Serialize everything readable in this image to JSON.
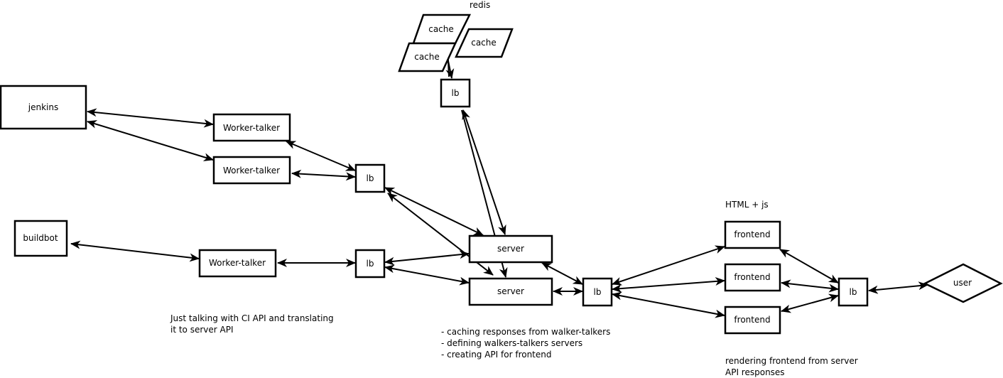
{
  "diagram": {
    "colors": {
      "stroke": "#000000",
      "fill": "#ffffff",
      "text": "#000000"
    },
    "nodes": [
      {
        "id": "jenkins",
        "label": "jenkins",
        "shape": "rect"
      },
      {
        "id": "wt1",
        "label": "Worker-talker",
        "shape": "rect"
      },
      {
        "id": "wt2",
        "label": "Worker-talker",
        "shape": "rect"
      },
      {
        "id": "buildbot",
        "label": "buildbot",
        "shape": "rect"
      },
      {
        "id": "wt3",
        "label": "Worker-talker",
        "shape": "rect"
      },
      {
        "id": "lb1",
        "label": "lb",
        "shape": "rect"
      },
      {
        "id": "lb2",
        "label": "lb",
        "shape": "rect"
      },
      {
        "id": "cache1",
        "label": "cache",
        "shape": "parallelogram"
      },
      {
        "id": "cache2",
        "label": "cache",
        "shape": "parallelogram"
      },
      {
        "id": "cache3",
        "label": "cache",
        "shape": "parallelogram"
      },
      {
        "id": "lb_redis",
        "label": "lb",
        "shape": "rect"
      },
      {
        "id": "server1",
        "label": "server",
        "shape": "rect"
      },
      {
        "id": "server2",
        "label": "server",
        "shape": "rect"
      },
      {
        "id": "lb3",
        "label": "lb",
        "shape": "rect"
      },
      {
        "id": "fe1",
        "label": "frontend",
        "shape": "rect"
      },
      {
        "id": "fe2",
        "label": "frontend",
        "shape": "rect"
      },
      {
        "id": "fe3",
        "label": "frontend",
        "shape": "rect"
      },
      {
        "id": "lb4",
        "label": "lb",
        "shape": "rect"
      },
      {
        "id": "user",
        "label": "user",
        "shape": "diamond"
      }
    ],
    "edges": [
      {
        "from": "jenkins",
        "to": "wt1",
        "bidirectional": true
      },
      {
        "from": "jenkins",
        "to": "wt2",
        "bidirectional": true
      },
      {
        "from": "wt1",
        "to": "lb1",
        "bidirectional": true
      },
      {
        "from": "wt2",
        "to": "lb1",
        "bidirectional": true
      },
      {
        "from": "buildbot",
        "to": "wt3",
        "bidirectional": true
      },
      {
        "from": "wt3",
        "to": "lb2",
        "bidirectional": true
      },
      {
        "from": "lb1",
        "to": "server1",
        "bidirectional": true
      },
      {
        "from": "lb1",
        "to": "server2",
        "bidirectional": true
      },
      {
        "from": "lb2",
        "to": "server1",
        "bidirectional": true
      },
      {
        "from": "lb2",
        "to": "server2",
        "bidirectional": true
      },
      {
        "from": "cache3",
        "to": "lb_redis",
        "bidirectional": true
      },
      {
        "from": "lb_redis",
        "to": "server1",
        "bidirectional": true
      },
      {
        "from": "lb_redis",
        "to": "server2",
        "bidirectional": true
      },
      {
        "from": "server1",
        "to": "lb3",
        "bidirectional": true
      },
      {
        "from": "server2",
        "to": "lb3",
        "bidirectional": true
      },
      {
        "from": "lb3",
        "to": "fe1",
        "bidirectional": true
      },
      {
        "from": "lb3",
        "to": "fe2",
        "bidirectional": true
      },
      {
        "from": "lb3",
        "to": "fe3",
        "bidirectional": true
      },
      {
        "from": "fe1",
        "to": "lb4",
        "bidirectional": true
      },
      {
        "from": "fe2",
        "to": "lb4",
        "bidirectional": true
      },
      {
        "from": "fe3",
        "to": "lb4",
        "bidirectional": true
      },
      {
        "from": "lb4",
        "to": "user",
        "bidirectional": true
      }
    ],
    "annotations": {
      "redis": "redis",
      "html_js": "HTML + js",
      "worker_note": [
        "Just talking with CI API and translating",
        "it to server API"
      ],
      "server_note": [
        "- caching responses from walker-talkers",
        "- defining walkers-talkers servers",
        "- creating API for frontend"
      ],
      "frontend_note": [
        "rendering frontend from server",
        "API responses"
      ]
    }
  }
}
